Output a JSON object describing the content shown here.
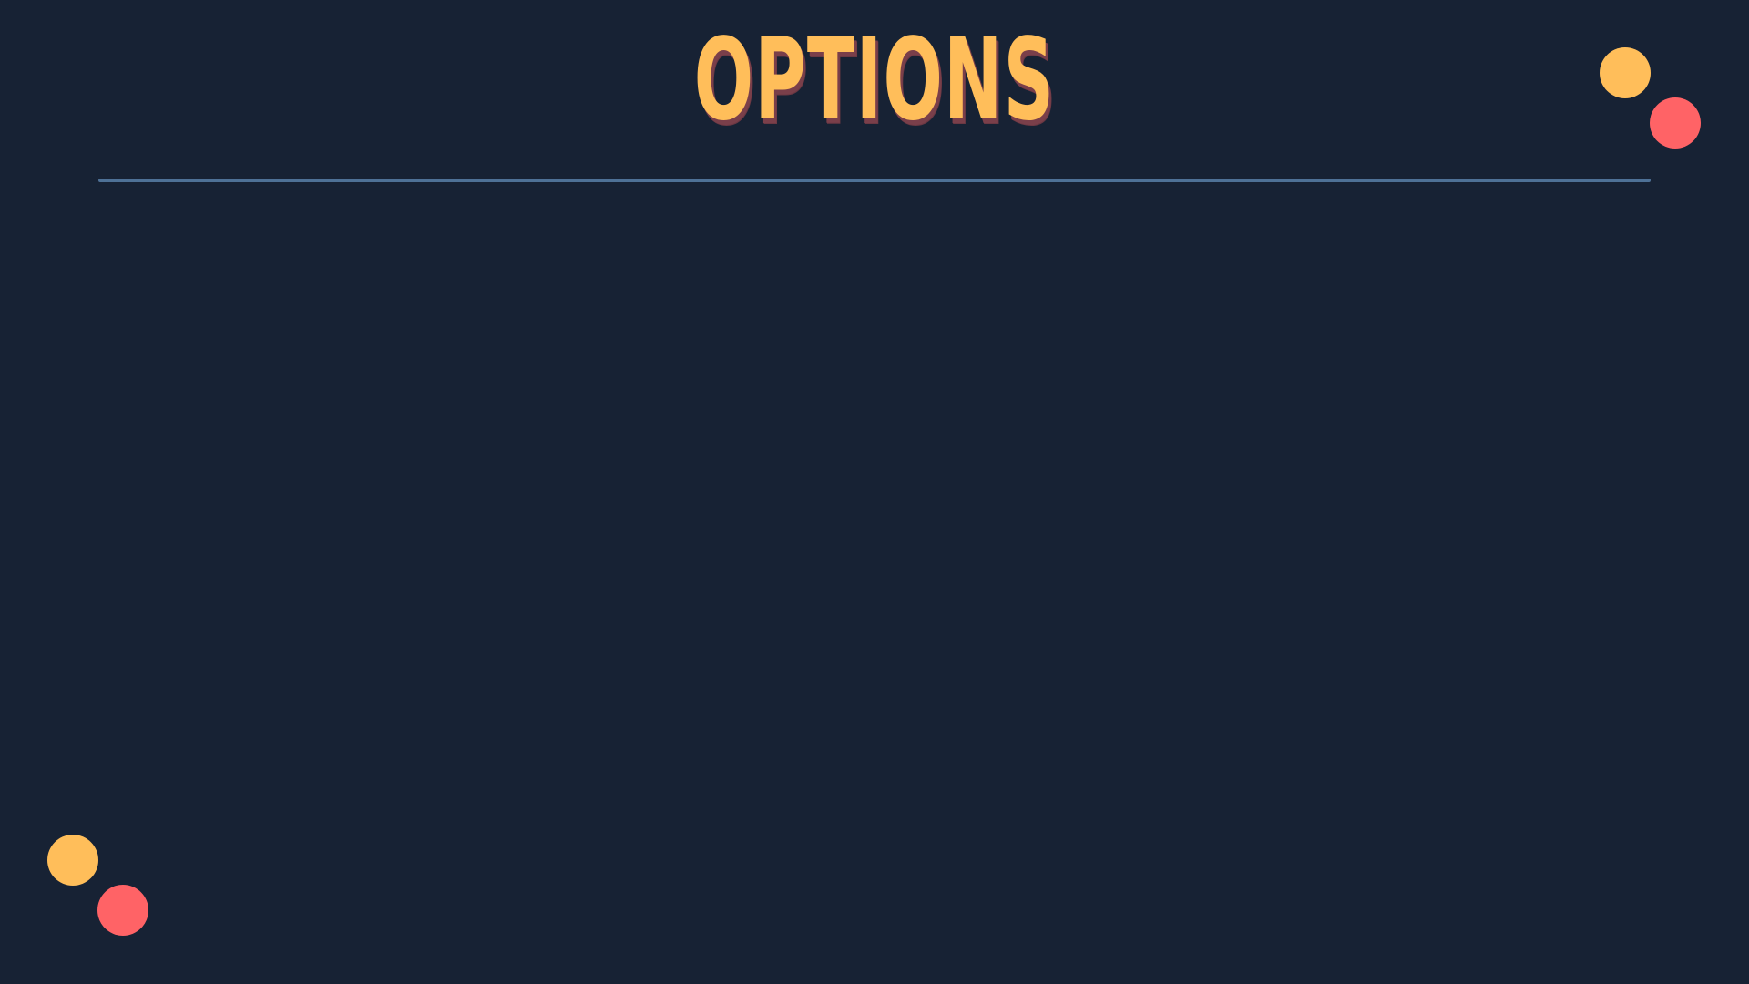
{
  "slide": {
    "title": "OPTIONS"
  },
  "theme": {
    "background": "#172234",
    "title_color": "#FFBE5A",
    "title_shadow": "#7A3F4A",
    "divider_color": "#4E7196",
    "accent_yellow": "#FFBE5A",
    "accent_red": "#FF6366"
  },
  "decorations": [
    {
      "name": "accent-dot-yellow-top-right",
      "color": "#FFBE5A"
    },
    {
      "name": "accent-dot-red-top-right",
      "color": "#FF6366"
    },
    {
      "name": "accent-dot-yellow-bottom-left",
      "color": "#FFBE5A"
    },
    {
      "name": "accent-dot-red-bottom-left",
      "color": "#FF6366"
    }
  ]
}
